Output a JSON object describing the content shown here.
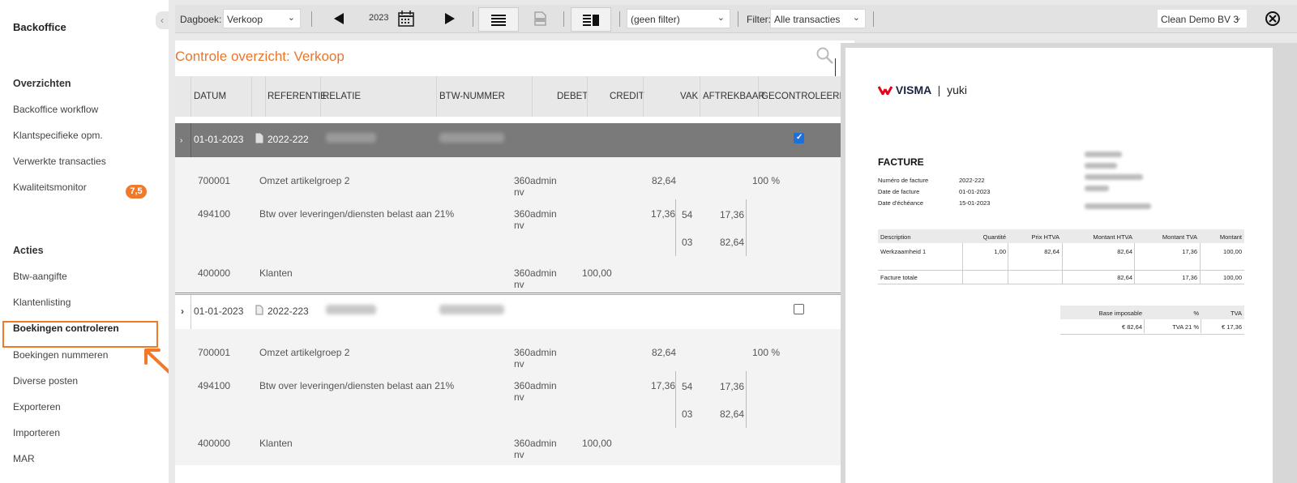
{
  "sidebar": {
    "title": "Backoffice",
    "collapse_icon": "‹",
    "sections": [
      {
        "label": "Overzichten",
        "items": [
          "Backoffice workflow",
          "Klantspecifieke opm.",
          "Verwerkte transacties",
          "Kwaliteitsmonitor"
        ]
      },
      {
        "label": "Acties",
        "items": [
          "Btw-aangifte",
          "Klantenlisting",
          "Boekingen controleren",
          "Boekingen nummeren",
          "Diverse posten",
          "Exporteren",
          "Importeren",
          "MAR"
        ]
      }
    ],
    "badge": "7,5",
    "active_item": "Boekingen controleren",
    "accent_color": "#f07a2a"
  },
  "toolbar": {
    "dagboek_label": "Dagboek:",
    "dagboek_value": "Verkoop",
    "year": "2023",
    "filter_value": "(geen filter)",
    "filter_label": "Filter:",
    "filter2_value": "Alle transacties",
    "company": "Clean Demo BV 3"
  },
  "overview": {
    "title": "Controle overzicht: Verkoop",
    "columns": [
      "DATUM",
      "REFERENTIE",
      "RELATIE",
      "BTW-NUMMER",
      "DEBET",
      "CREDIT",
      "VAK",
      "AFTREKBAAR",
      "GECONTROLEERD"
    ],
    "transactions": [
      {
        "date": "01-01-2023",
        "reference": "2022-222",
        "checked": true,
        "selected": true,
        "lines": [
          {
            "account": "700001",
            "description": "Omzet artikelgroep 2",
            "user": "360admin",
            "user2": "nv",
            "debet": "",
            "credit": "82,64",
            "deductible": "100 %"
          },
          {
            "account": "494100",
            "description": "Btw over leveringen/diensten belast aan 21%",
            "user": "360admin",
            "user2": "nv",
            "debet": "",
            "credit": "17,36",
            "vak": [
              {
                "code": "54",
                "amount": "17,36"
              },
              {
                "code": "03",
                "amount": "82,64"
              }
            ]
          },
          {
            "account": "400000",
            "description": "Klanten",
            "user": "360admin",
            "user2": "nv",
            "debet": "100,00",
            "credit": ""
          }
        ]
      },
      {
        "date": "01-01-2023",
        "reference": "2022-223",
        "checked": false,
        "selected": false,
        "lines": [
          {
            "account": "700001",
            "description": "Omzet artikelgroep 2",
            "user": "360admin",
            "user2": "nv",
            "debet": "",
            "credit": "82,64",
            "deductible": "100 %"
          },
          {
            "account": "494100",
            "description": "Btw over leveringen/diensten belast aan 21%",
            "user": "360admin",
            "user2": "nv",
            "debet": "",
            "credit": "17,36",
            "vak": [
              {
                "code": "54",
                "amount": "17,36"
              },
              {
                "code": "03",
                "amount": "82,64"
              }
            ]
          },
          {
            "account": "400000",
            "description": "Klanten",
            "user": "360admin",
            "user2": "nv",
            "debet": "100,00",
            "credit": ""
          }
        ]
      }
    ]
  },
  "invoice": {
    "brand": "VISMA",
    "brand_sub": "yuki",
    "title": "FACTURE",
    "meta": [
      {
        "label": "Numéro de facture",
        "value": "2022-222"
      },
      {
        "label": "Date de facture",
        "value": "01-01-2023"
      },
      {
        "label": "Date d'échéance",
        "value": "15-01-2023"
      }
    ],
    "columns": [
      "Description",
      "Quantité",
      "Prix HTVA",
      "Montant HTVA",
      "Montant TVA",
      "Montant"
    ],
    "rows": [
      [
        "Werkzaamheid 1",
        "1,00",
        "82,64",
        "82,64",
        "17,36",
        "100,00"
      ]
    ],
    "total_row": [
      "Facture totale",
      "",
      "",
      "82,64",
      "17,36",
      "100,00"
    ],
    "vat_columns": [
      "Base imposable",
      "%",
      "TVA"
    ],
    "vat_row": [
      "€ 82,64",
      "TVA 21 %",
      "€ 17,36"
    ]
  }
}
